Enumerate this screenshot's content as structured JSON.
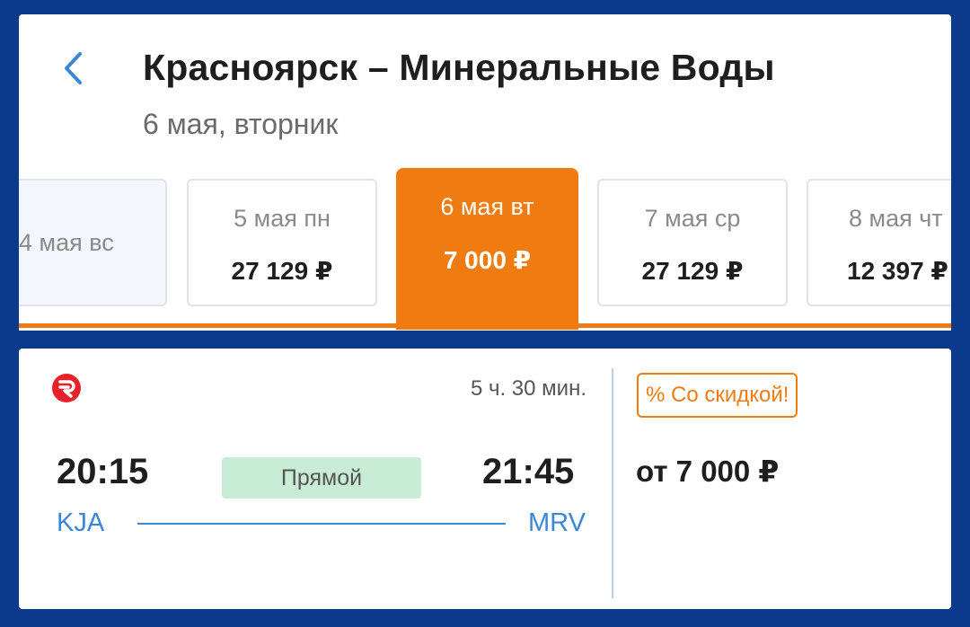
{
  "header": {
    "title": "Красноярск – Минеральные Воды",
    "subtitle": "6 мая, вторник",
    "back_icon": "chevron-left-icon"
  },
  "dates": [
    {
      "label": "4 мая вс",
      "price": ""
    },
    {
      "label": "5 мая пн",
      "price": "27 129 ₽"
    },
    {
      "label": "6 мая вт",
      "price": "7 000 ₽",
      "selected": true
    },
    {
      "label": "7 мая ср",
      "price": "27 129 ₽"
    },
    {
      "label": "8 мая чт",
      "price": "12 397 ₽"
    }
  ],
  "flight": {
    "airline_logo": "airline-logo-icon",
    "duration": "5 ч. 30 мин.",
    "departure_time": "20:15",
    "arrival_time": "21:45",
    "departure_code": "KJA",
    "arrival_code": "MRV",
    "stops_label": "Прямой",
    "discount_label": "% Со скидкой!",
    "price": "от 7 000 ₽"
  },
  "colors": {
    "accent_orange": "#f07c11",
    "brand_blue": "#0b3a8c",
    "link_blue": "#3a86d8",
    "direct_green": "#c8ecd6"
  }
}
